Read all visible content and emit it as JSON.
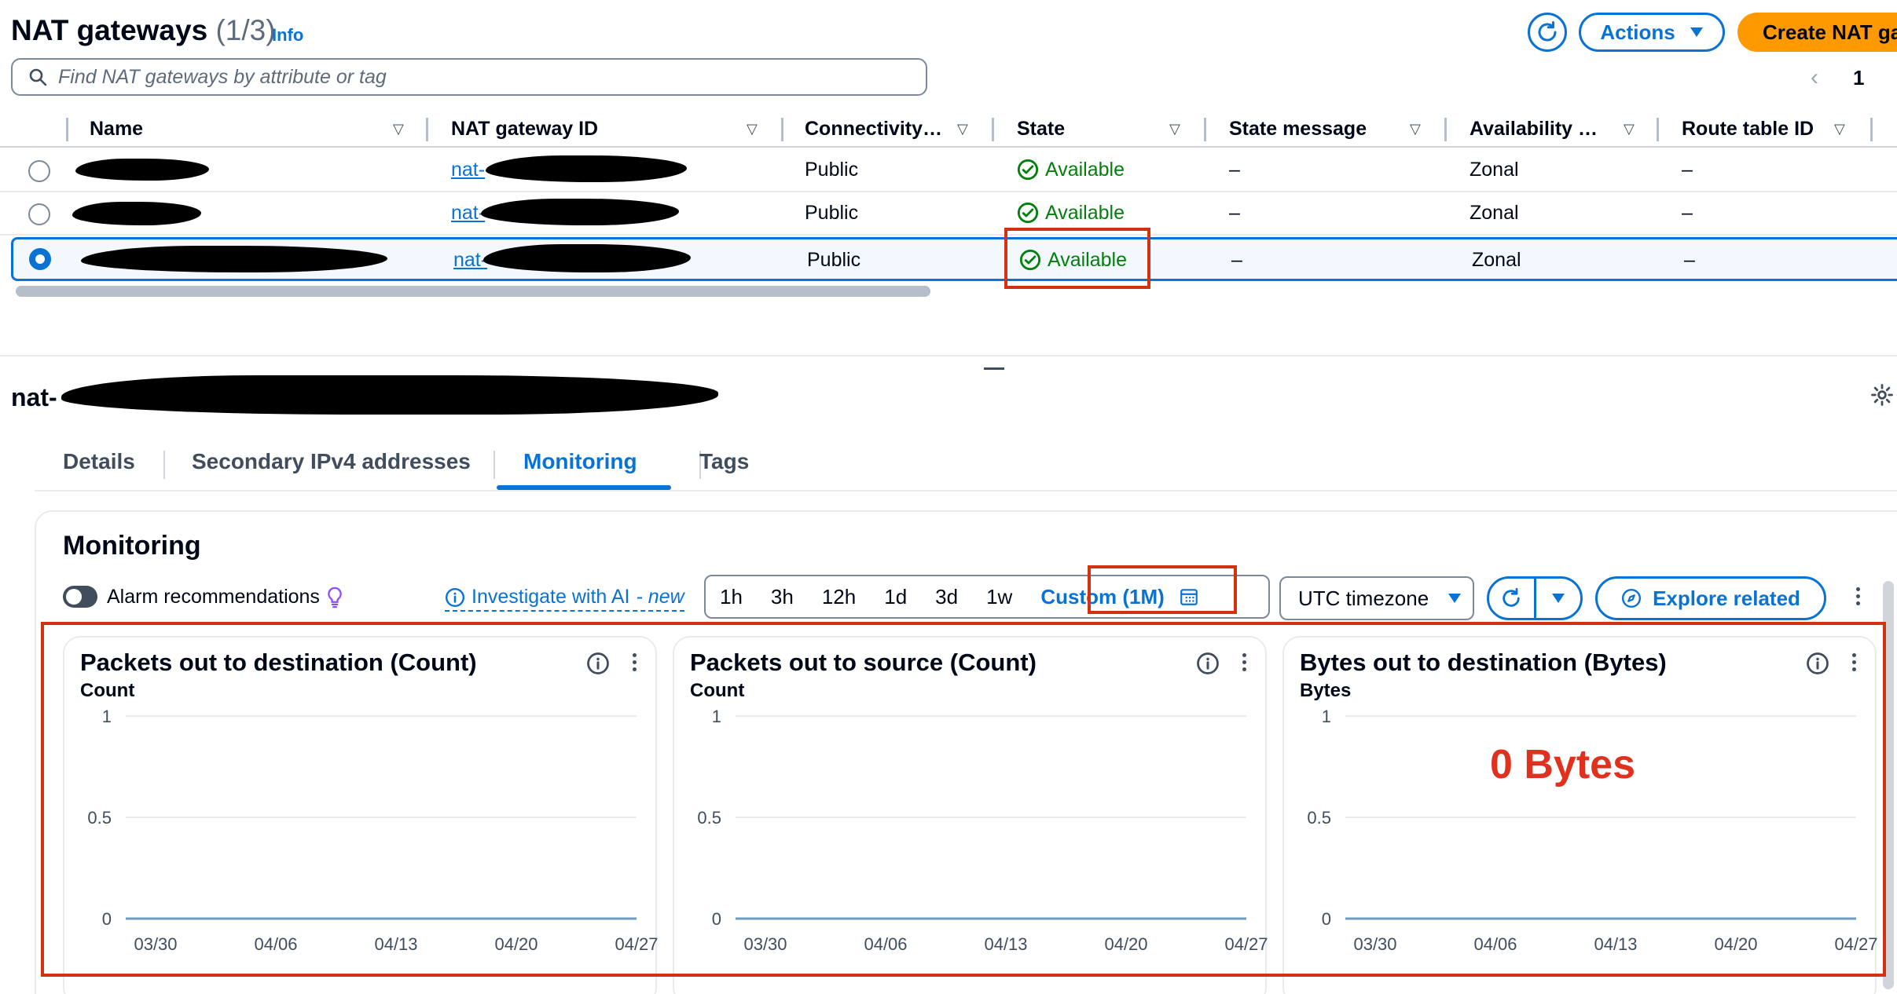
{
  "header": {
    "title": "NAT gateways",
    "count": "(1/3)",
    "info": "Info",
    "actions_label": "Actions",
    "create_label": "Create NAT gateway",
    "search_placeholder": "Find NAT gateways by attribute or tag",
    "page": "1"
  },
  "table": {
    "columns": [
      "Name",
      "NAT gateway ID",
      "Connectivity…",
      "State",
      "State message",
      "Availability …",
      "Route table ID"
    ],
    "rows": [
      {
        "id_prefix": "nat-",
        "connectivity": "Public",
        "state": "Available",
        "state_message": "–",
        "availability": "Zonal",
        "route_table": "–",
        "selected": false
      },
      {
        "id_prefix": "nat-",
        "connectivity": "Public",
        "state": "Available",
        "state_message": "–",
        "availability": "Zonal",
        "route_table": "–",
        "selected": false
      },
      {
        "id_prefix": "nat-",
        "connectivity": "Public",
        "state": "Available",
        "state_message": "–",
        "availability": "Zonal",
        "route_table": "–",
        "selected": true
      }
    ]
  },
  "detail": {
    "title_prefix": "nat-",
    "tabs": [
      "Details",
      "Secondary IPv4 addresses",
      "Monitoring",
      "Tags"
    ],
    "active_tab": "Monitoring"
  },
  "monitoring": {
    "title": "Monitoring",
    "alarm_label": "Alarm recommendations",
    "investigate_label": "Investigate with AI",
    "investigate_new": "- new",
    "ranges": [
      "1h",
      "3h",
      "12h",
      "1d",
      "3d",
      "1w",
      "Custom (1M)"
    ],
    "active_range": "Custom (1M)",
    "timezone": "UTC timezone",
    "explore_label": "Explore related"
  },
  "chart_data": [
    {
      "type": "line",
      "title": "Packets out to destination (Count)",
      "ylabel": "Count",
      "yticks": [
        "1",
        "0.5",
        "0"
      ],
      "ylim": [
        0,
        1
      ],
      "x": [
        "03/30",
        "04/06",
        "04/13",
        "04/20",
        "04/27"
      ],
      "series": [
        {
          "values": [
            0,
            0,
            0,
            0,
            0
          ]
        }
      ],
      "grid": true
    },
    {
      "type": "line",
      "title": "Packets out to source (Count)",
      "ylabel": "Count",
      "yticks": [
        "1",
        "0.5",
        "0"
      ],
      "ylim": [
        0,
        1
      ],
      "x": [
        "03/30",
        "04/06",
        "04/13",
        "04/20",
        "04/27"
      ],
      "series": [
        {
          "values": [
            0,
            0,
            0,
            0,
            0
          ]
        }
      ],
      "grid": true
    },
    {
      "type": "line",
      "title": "Bytes out to destination (Bytes)",
      "ylabel": "Bytes",
      "yticks": [
        "1",
        "0.5",
        "0"
      ],
      "ylim": [
        0,
        1
      ],
      "x": [
        "03/30",
        "04/06",
        "04/13",
        "04/20",
        "04/27"
      ],
      "series": [
        {
          "values": [
            0,
            0,
            0,
            0,
            0
          ]
        }
      ],
      "annotation": "0 Bytes",
      "grid": true
    }
  ],
  "colors": {
    "accent": "#0972d3",
    "primary_button": "#ff9900",
    "success": "#037f0c",
    "highlight": "#d13212",
    "series": "#6b9bc3"
  }
}
